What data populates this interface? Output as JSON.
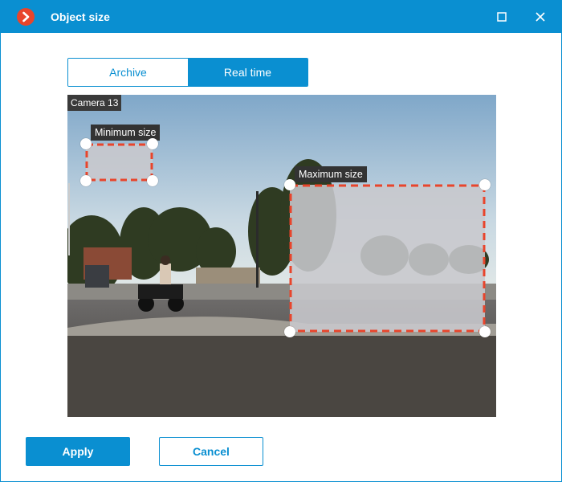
{
  "window": {
    "title": "Object size",
    "accent": "#0a8fd1",
    "brand_icon": "chevron-right-logo-icon",
    "maximize_icon": "maximize-icon",
    "close_icon": "close-icon"
  },
  "tabs": {
    "items": [
      {
        "label": "Archive",
        "selected": false
      },
      {
        "label": "Real time",
        "selected": true
      }
    ]
  },
  "video": {
    "camera_label": "Camera 13",
    "min_zone_label": "Minimum size",
    "max_zone_label": "Maximum size",
    "zone_border_color": "#e8452c"
  },
  "actions": {
    "apply_label": "Apply",
    "cancel_label": "Cancel"
  }
}
